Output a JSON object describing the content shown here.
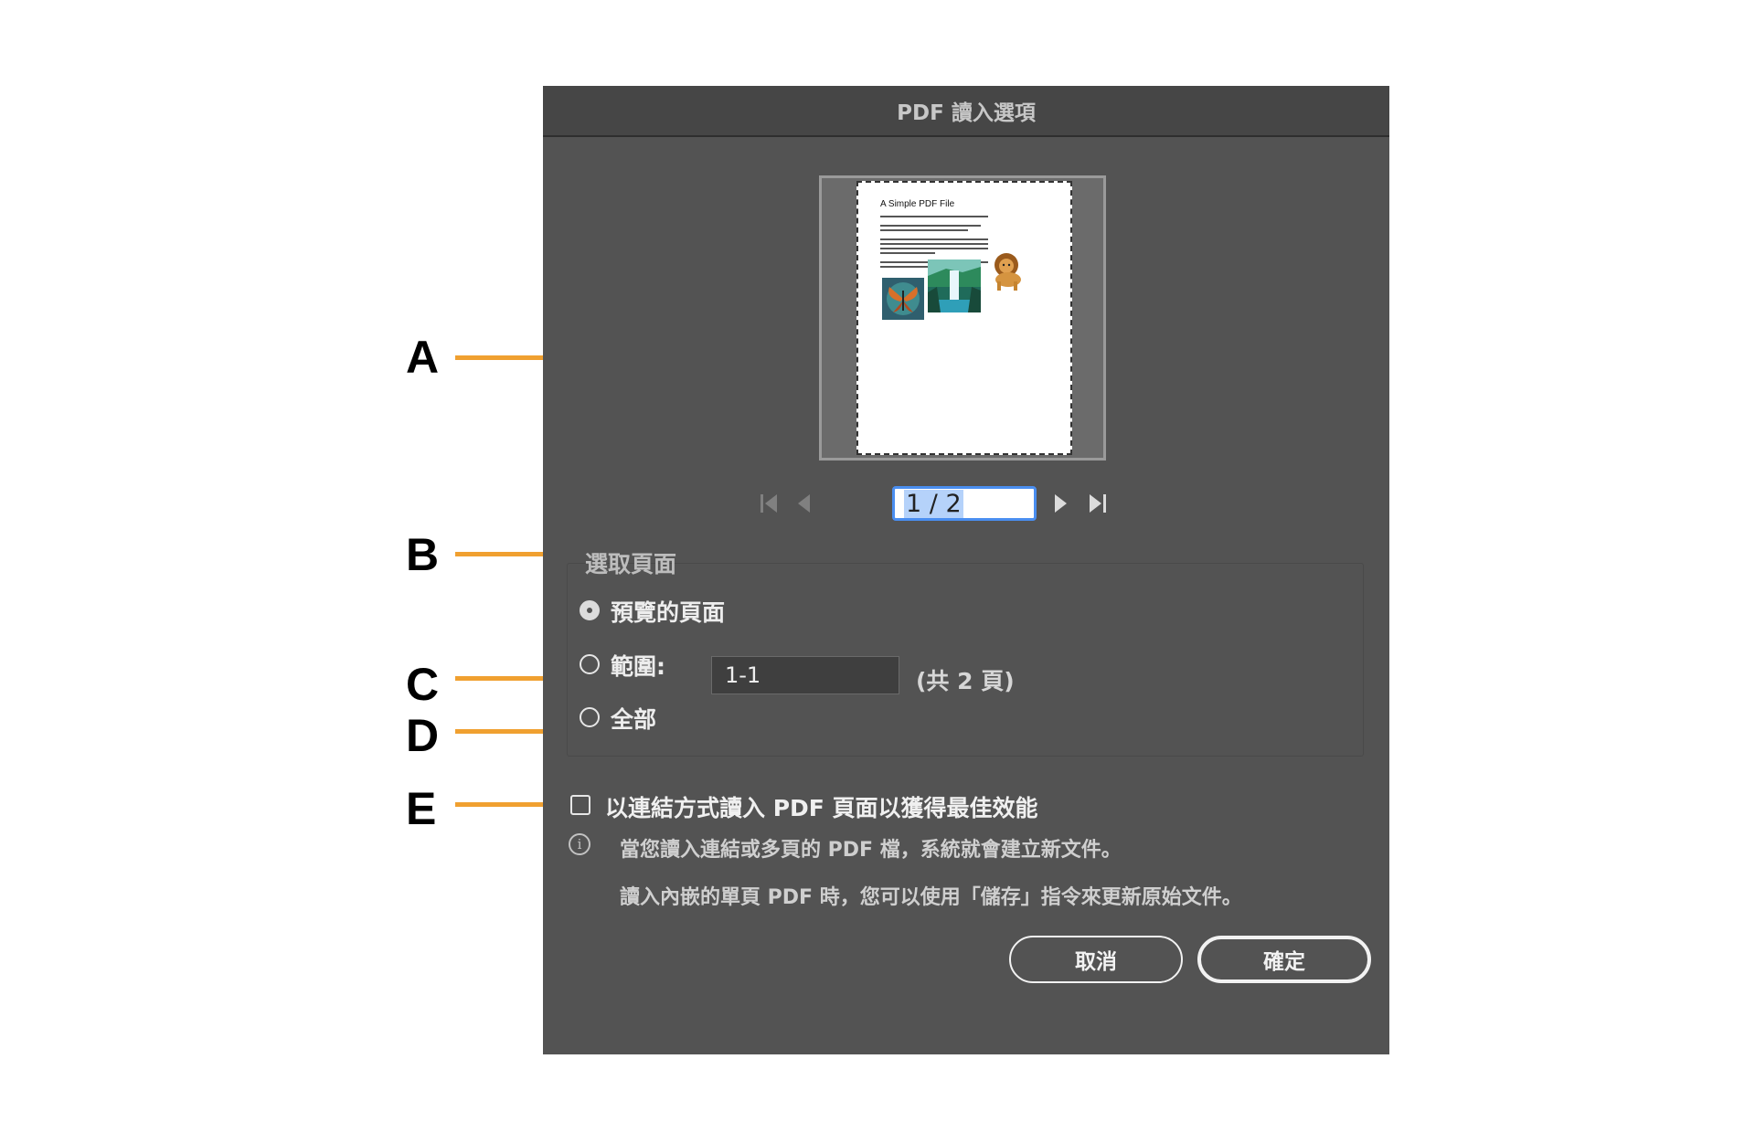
{
  "dialog": {
    "title": "PDF 讀入選項",
    "preview": {
      "page_title": "A Simple PDF File"
    },
    "navigator": {
      "page_value": "1 / 2"
    },
    "select_pages": {
      "group_label": "選取頁面",
      "options": [
        {
          "label": "預覽的頁面",
          "checked": true
        },
        {
          "label": "範圍:",
          "checked": false
        },
        {
          "label": "全部",
          "checked": false
        }
      ],
      "range_value": "1-1",
      "range_note": "(共 2 頁)"
    },
    "link_option": {
      "label": "以連結方式讀入 PDF 頁面以獲得最佳效能",
      "checked": false
    },
    "info": {
      "line1": "當您讀入連結或多頁的 PDF 檔，系統就會建立新文件。",
      "line2": "讀入內嵌的單頁 PDF 時，您可以使用「儲存」指令來更新原始文件。"
    },
    "buttons": {
      "cancel": "取消",
      "ok": "確定"
    }
  },
  "callouts": [
    "A",
    "B",
    "C",
    "D",
    "E"
  ],
  "colors": {
    "dialog_bg": "#535353",
    "callout": "#f0a030",
    "focus": "#4a8ef0"
  }
}
